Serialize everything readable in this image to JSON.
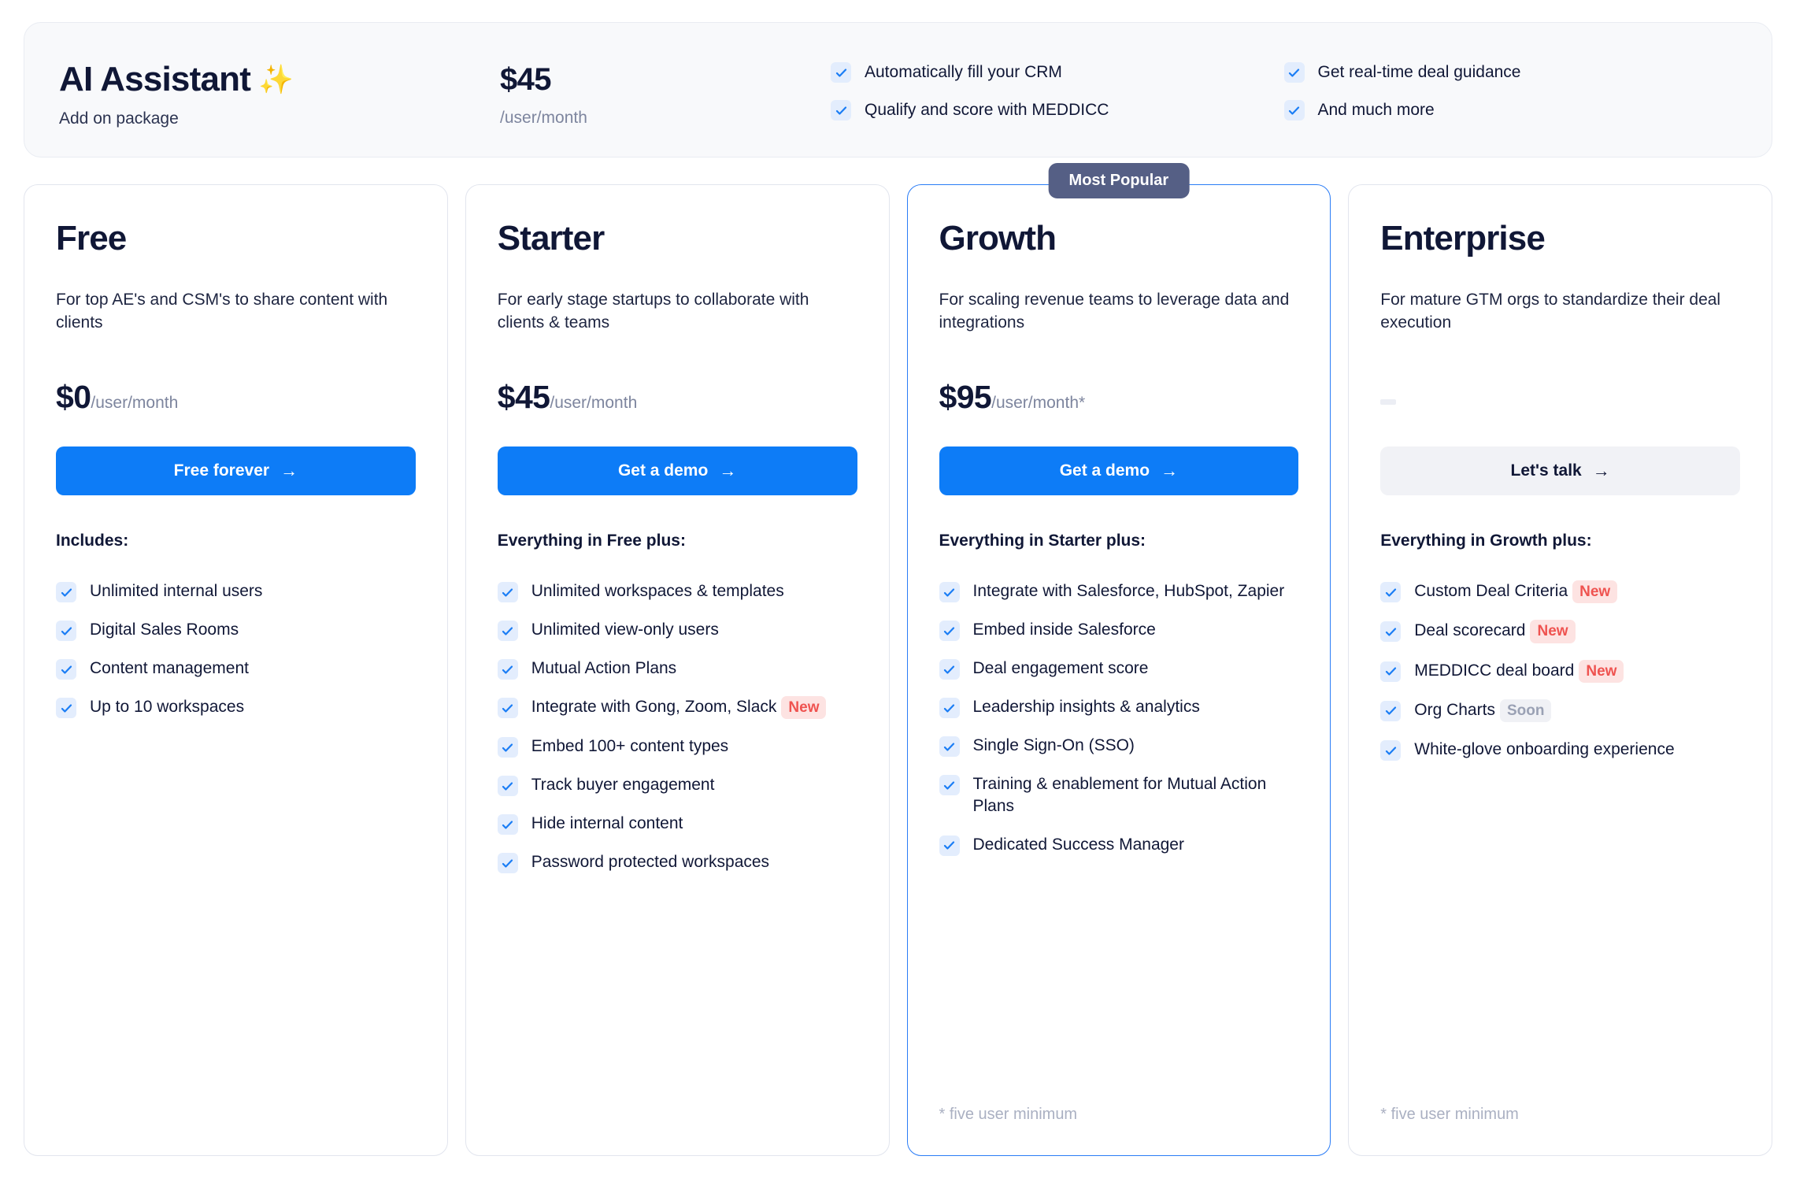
{
  "addon": {
    "title": "AI Assistant",
    "sparkle_icon": "✨",
    "subtitle": "Add on package",
    "price": "$45",
    "price_unit": "/user/month",
    "features_col1": [
      "Automatically fill your CRM",
      "Qualify and score with MEDDICC"
    ],
    "features_col2": [
      "Get real-time deal guidance",
      "And much more"
    ]
  },
  "colors": {
    "accent_blue": "#0d7cf7",
    "featured_border": "#2a7cf6",
    "popular_badge": "#555f85",
    "check_bg": "#e3edfd",
    "check_mark": "#1a7df5",
    "badge_new_bg": "#fde3e2",
    "badge_new_text": "#ef5350",
    "badge_soon_bg": "#f0f1f5",
    "badge_soon_text": "#9aa1b4",
    "heading": "#101736",
    "muted": "#7d859e",
    "banner_bg": "#f8f9fb"
  },
  "plans": [
    {
      "name": "Free",
      "description": "For top AE's and CSM's to share content with clients",
      "price": "$0",
      "price_unit": "/user/month",
      "cta_label": "Free forever",
      "cta_arrow": "→",
      "cta_style": "primary",
      "includes_title": "Includes:",
      "badge": null,
      "footnote": "",
      "features": [
        {
          "text": "Unlimited internal users",
          "badge": null
        },
        {
          "text": "Digital Sales Rooms",
          "badge": null
        },
        {
          "text": "Content management",
          "badge": null
        },
        {
          "text": "Up to 10 workspaces",
          "badge": null
        }
      ]
    },
    {
      "name": "Starter",
      "description": "For early stage startups to collaborate with clients & teams",
      "price": "$45",
      "price_unit": "/user/month",
      "cta_label": "Get a demo",
      "cta_arrow": "→",
      "cta_style": "primary",
      "includes_title": "Everything in Free plus:",
      "badge": null,
      "footnote": "",
      "features": [
        {
          "text": "Unlimited workspaces & templates",
          "badge": null
        },
        {
          "text": "Unlimited view-only users",
          "badge": null
        },
        {
          "text": "Mutual Action Plans",
          "badge": null
        },
        {
          "text": "Integrate with Gong, Zoom, Slack",
          "badge": "New"
        },
        {
          "text": "Embed 100+ content types",
          "badge": null
        },
        {
          "text": "Track buyer engagement",
          "badge": null
        },
        {
          "text": "Hide internal content",
          "badge": null
        },
        {
          "text": "Password protected workspaces",
          "badge": null
        }
      ]
    },
    {
      "name": "Growth",
      "description": "For scaling revenue teams to leverage data and integrations",
      "price": "$95",
      "price_unit": "/user/month*",
      "cta_label": "Get a demo",
      "cta_arrow": "→",
      "cta_style": "primary",
      "includes_title": "Everything in Starter plus:",
      "badge": "Most Popular",
      "footnote": "* five user minimum",
      "features": [
        {
          "text": "Integrate with Salesforce, HubSpot, Zapier",
          "badge": null
        },
        {
          "text": "Embed inside Salesforce",
          "badge": null
        },
        {
          "text": "Deal engagement score",
          "badge": null
        },
        {
          "text": "Leadership insights & analytics",
          "badge": null
        },
        {
          "text": "Single Sign-On (SSO)",
          "badge": null
        },
        {
          "text": "Training & enablement for Mutual Action Plans",
          "badge": null
        },
        {
          "text": "Dedicated Success Manager",
          "badge": null
        }
      ]
    },
    {
      "name": "Enterprise",
      "description": "For mature GTM orgs to standardize their deal execution",
      "price": "",
      "price_unit": "",
      "cta_label": "Let's talk",
      "cta_arrow": "→",
      "cta_style": "ghost",
      "includes_title": "Everything in Growth plus:",
      "badge": null,
      "footnote": "* five user minimum",
      "features": [
        {
          "text": "Custom Deal Criteria",
          "badge": "New"
        },
        {
          "text": "Deal scorecard",
          "badge": "New"
        },
        {
          "text": "MEDDICC deal board",
          "badge": "New"
        },
        {
          "text": "Org Charts",
          "badge": "Soon"
        },
        {
          "text": "White-glove onboarding experience",
          "badge": null
        }
      ]
    }
  ]
}
